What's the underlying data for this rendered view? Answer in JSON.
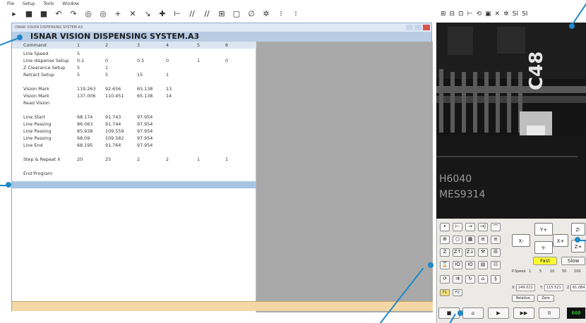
{
  "menubar": [
    "File",
    "Setup",
    "Tools",
    "Window"
  ],
  "toolbar": [
    "▸",
    "■",
    "■",
    "↶",
    "↷",
    "◎",
    "◎",
    "+",
    "✕",
    "↘",
    "✚",
    "⊢",
    "//",
    "//",
    "⊞",
    "▢",
    "∅",
    "✲",
    "⁝",
    "⁝"
  ],
  "window": {
    "title": "ISNAR VISION DISPENSING SYSTEM.A3",
    "header": "ISNAR VISION DISPENSING SYSTEM.A3"
  },
  "table": {
    "columns": [
      "Command",
      "1",
      "2",
      "3",
      "4",
      "5",
      "6"
    ],
    "rows": [
      [
        "Line Speed",
        "5",
        "",
        "",
        "",
        "",
        ""
      ],
      [
        "Line dispense Setup",
        "0.1",
        "0",
        "0.5",
        "0",
        "1",
        "0"
      ],
      [
        "Z Clearance Setup",
        "5",
        "1",
        "",
        "",
        "",
        ""
      ],
      [
        "Retract Setup",
        "5",
        "5",
        "15",
        "1",
        "",
        ""
      ],
      [
        "",
        "",
        "",
        "",
        "",
        "",
        ""
      ],
      [
        "Vision Mark",
        "119.263",
        "92.656",
        "65.138",
        "13",
        "",
        ""
      ],
      [
        "Vision Mark",
        "137.006",
        "110.451",
        "65.138",
        "14",
        "",
        ""
      ],
      [
        "Read Vision",
        "",
        "",
        "",
        "",
        "",
        ""
      ],
      [
        "",
        "",
        "",
        "",
        "",
        "",
        ""
      ],
      [
        "Line Start",
        "68.174",
        "91.743",
        "97.954",
        "",
        "",
        ""
      ],
      [
        "Line Passing",
        "86.063",
        "91.744",
        "97.954",
        "",
        "",
        ""
      ],
      [
        "Line Passing",
        "85.938",
        "109.559",
        "97.954",
        "",
        "",
        ""
      ],
      [
        "Line Passing",
        "68.09",
        "109.582",
        "97.954",
        "",
        "",
        ""
      ],
      [
        "Line End",
        "68.195",
        "91.764",
        "97.954",
        "",
        "",
        ""
      ],
      [
        "",
        "",
        "",
        "",
        "",
        "",
        ""
      ],
      [
        "Step & Repeat X",
        "20",
        "25",
        "2",
        "2",
        "1",
        "1"
      ],
      [
        "",
        "",
        "",
        "",
        "",
        "",
        ""
      ],
      [
        "End Program",
        "",
        "",
        "",
        "",
        "",
        ""
      ]
    ]
  },
  "camera": {
    "toolbar": [
      "⊞",
      "⊟",
      "⊡",
      "⊢",
      "⟲",
      "▣",
      "✕",
      "✲",
      "SI",
      "SI"
    ],
    "labels": [
      "C48",
      "H6040",
      "MES9314"
    ]
  },
  "controls": {
    "jog": {
      "y_plus": "Y+",
      "y_minus": "Y-",
      "x_minus": "X-",
      "x_plus": "X+",
      "z_minus": "Z-",
      "z_plus": "Z+"
    },
    "fast": "Fast",
    "slow": "Slow",
    "coords": {
      "x_label": "X:",
      "x_value": "249.021",
      "y_label": "Y:",
      "y_value": "115.521",
      "z_label": "Z:",
      "z_value": "61.084"
    },
    "relative": "Relative",
    "zero": "Zero",
    "f1": "F1",
    "f2": "F2",
    "lcd": "000",
    "speed_label": "P.Speed",
    "speed_options": [
      "1",
      "5",
      "10",
      "50",
      "100"
    ],
    "playback": [
      "■",
      "⌂",
      "▶",
      "▶▶",
      "II"
    ]
  },
  "colors": {
    "accent": "#1e88c8",
    "header": "#b8cce4",
    "selected_row": "#a7c4e5",
    "fast": "#ffff33",
    "status_bar": "#f5d7a6",
    "pcb_dark": "#121212"
  }
}
